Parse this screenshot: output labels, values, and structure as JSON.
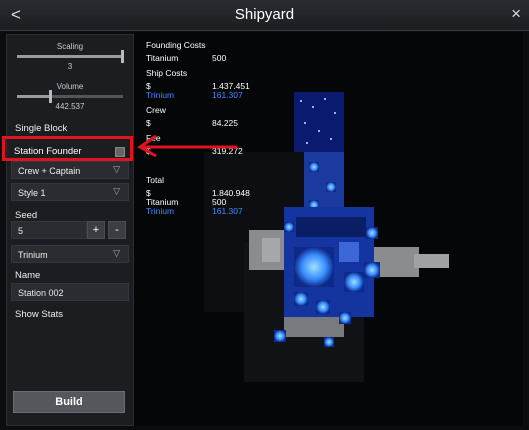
{
  "window": {
    "title": "Shipyard",
    "back_glyph": "<",
    "close_glyph": "×"
  },
  "sidebar": {
    "scaling": {
      "label": "Scaling",
      "value": "3",
      "level": 0.98
    },
    "volume": {
      "label": "Volume",
      "value": "442.537",
      "level": 0.3
    },
    "single_block_label": "Single Block",
    "station_founder_label": "Station Founder",
    "crew_dropdown": "Crew + Captain",
    "style_dropdown": "Style 1",
    "seed_label": "Seed",
    "seed_value": "5",
    "seed_plus": "+",
    "seed_minus": "-",
    "material_dropdown": "Trinium",
    "name_label": "Name",
    "name_value": "Station 002",
    "show_stats_label": "Show Stats",
    "build_label": "Build"
  },
  "costs": {
    "founding_header": "Founding Costs",
    "founding_rows": [
      {
        "label": "Titanium",
        "value": "500"
      }
    ],
    "ship_header": "Ship Costs",
    "ship_rows": [
      {
        "label": "$",
        "value": "1.437.451",
        "color": "#ffffff"
      },
      {
        "label": "Trinium",
        "value": "161.307",
        "color": "#3a8cff"
      }
    ],
    "crew_header": "Crew",
    "crew_rows": [
      {
        "label": "$",
        "value": "84.225"
      }
    ],
    "fee_header": "Fee",
    "fee_rows": [
      {
        "label": "$",
        "value": "319.272"
      }
    ],
    "total_header": "Total",
    "total_rows": [
      {
        "label": "$",
        "value": "1.840.948",
        "color": "#ffffff"
      },
      {
        "label": "Titanium",
        "value": "500",
        "color": "#ffffff"
      },
      {
        "label": "Trinium",
        "value": "161.307",
        "color": "#3a8cff"
      }
    ]
  },
  "colors": {
    "annotation": "#e0141e",
    "trinium": "#3a8cff",
    "block_glow": "#3aa6ff"
  }
}
